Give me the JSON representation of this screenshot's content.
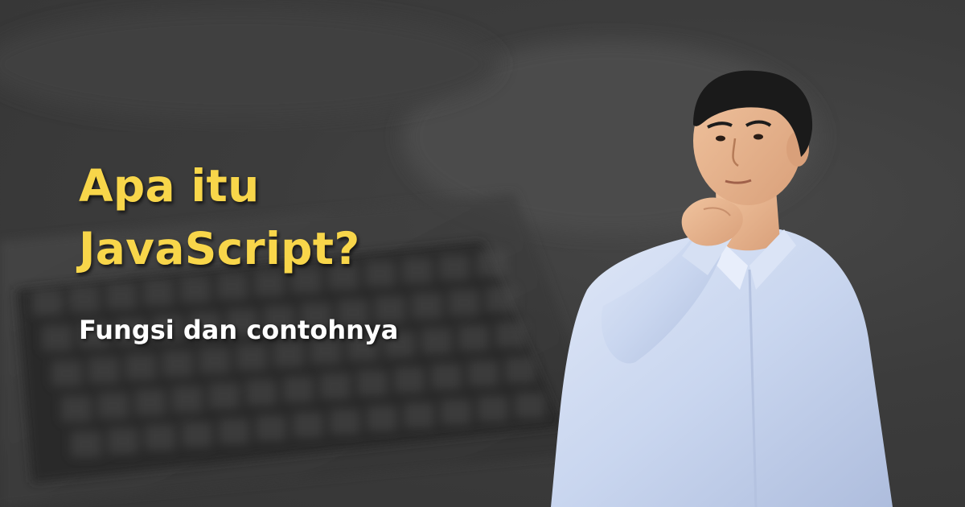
{
  "headline": {
    "line1": "Apa itu",
    "line2": "JavaScript?"
  },
  "subtitle": "Fungsi dan contohnya",
  "colors": {
    "background": "#3a3a3a",
    "headline": "#f8d64a",
    "subtitle": "#ffffff",
    "shirt": "#c9d6ef",
    "skin": "#e8b58f",
    "hair": "#1a1a1a"
  },
  "images": {
    "background": "blurred-laptop-keyboard-photo",
    "foreground": "thinking-man-in-light-blue-shirt"
  }
}
